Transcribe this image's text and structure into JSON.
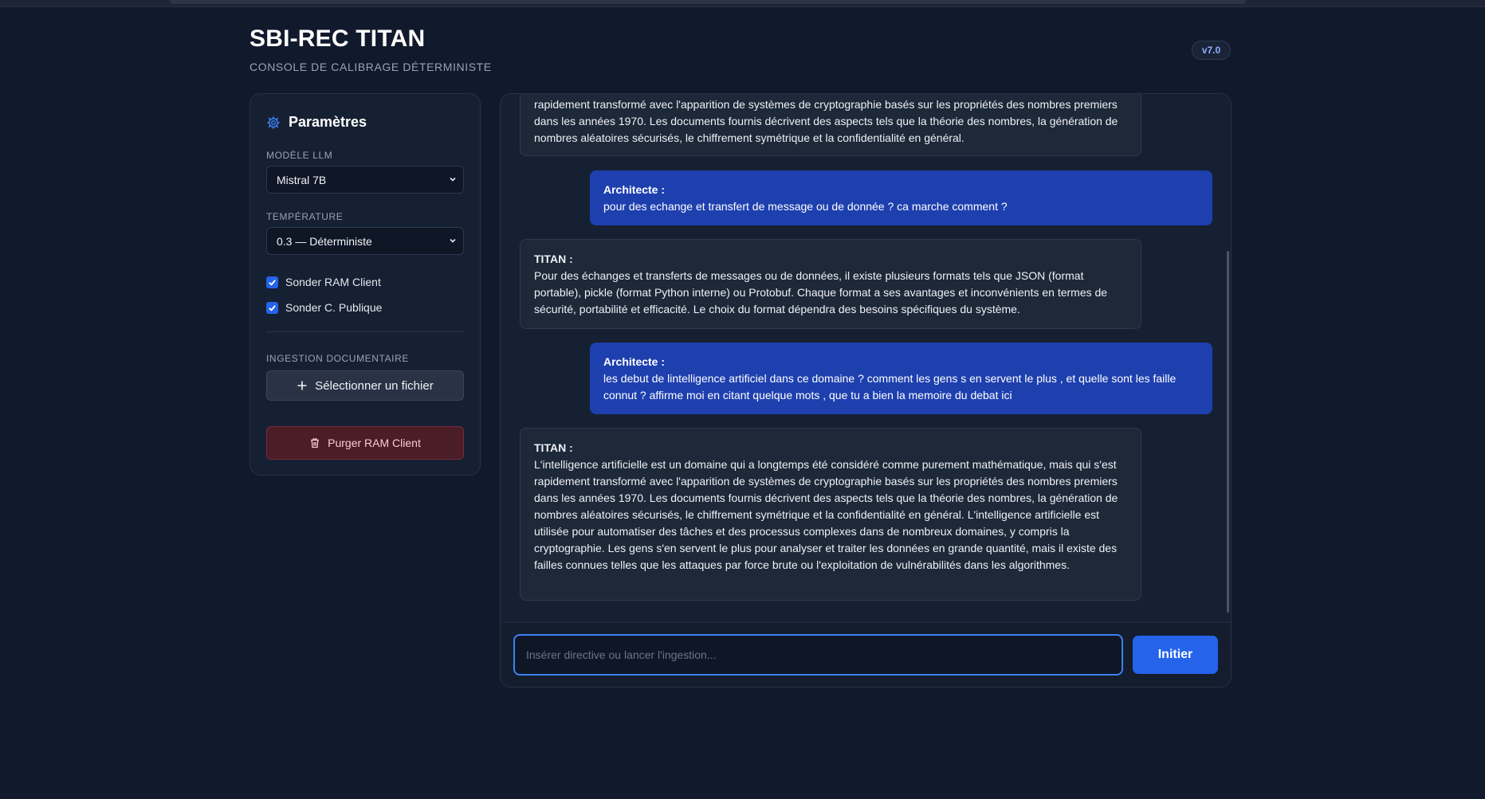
{
  "header": {
    "title": "SBI-REC TITAN",
    "subtitle": "CONSOLE DE CALIBRAGE DÉTERMINISTE",
    "version": "v7.0"
  },
  "sidebar": {
    "title": "Paramètres",
    "model_label": "MODÈLE LLM",
    "model_value": "Mistral 7B",
    "temperature_label": "TEMPÉRATURE",
    "temperature_value": "0.3 — Déterministe",
    "checkboxes": [
      {
        "label": "Sonder RAM Client",
        "checked": true
      },
      {
        "label": "Sonder C. Publique",
        "checked": true
      }
    ],
    "ingestion_label": "INGESTION DOCUMENTAIRE",
    "file_button": "Sélectionner un fichier",
    "purge_button": "Purger RAM Client"
  },
  "messages": [
    {
      "role": "titan",
      "text": "rapidement transformé avec l'apparition de systèmes de cryptographie basés sur les propriétés des nombres premiers dans les années 1970. Les documents fournis décrivent des aspects tels que la théorie des nombres, la génération de nombres aléatoires sécurisés, le chiffrement symétrique et la confidentialité en général."
    },
    {
      "role": "user",
      "speaker": "Architecte :",
      "text": "pour des echange et transfert de message ou de donnée ? ca marche comment ?"
    },
    {
      "role": "titan",
      "speaker": "TITAN :",
      "text": "Pour des échanges et transferts de messages ou de données, il existe plusieurs formats tels que JSON (format portable), pickle (format Python interne) ou Protobuf. Chaque format a ses avantages et inconvénients en termes de sécurité, portabilité et efficacité. Le choix du format dépendra des besoins spécifiques du système."
    },
    {
      "role": "user",
      "speaker": "Architecte :",
      "text": "les debut de lintelligence artificiel dans ce domaine ? comment les gens s en servent le plus , et quelle sont les faille connut ? affirme moi en citant quelque mots , que tu a bien la memoire du debat ici"
    },
    {
      "role": "titan",
      "speaker": "TITAN :",
      "text": "L'intelligence artificielle est un domaine qui a longtemps été considéré comme purement mathématique, mais qui s'est rapidement transformé avec l'apparition de systèmes de cryptographie basés sur les propriétés des nombres premiers dans les années 1970. Les documents fournis décrivent des aspects tels que la théorie des nombres, la génération de nombres aléatoires sécurisés, le chiffrement symétrique et la confidentialité en général. L'intelligence artificielle est utilisée pour automatiser des tâches et des processus complexes dans de nombreux domaines, y compris la cryptographie. Les gens s'en servent le plus pour analyser et traiter les données en grande quantité, mais il existe des failles connues telles que les attaques par force brute ou l'exploitation de vulnérabilités dans les algorithmes."
    }
  ],
  "composer": {
    "placeholder": "Insérer directive ou lancer l'ingestion...",
    "send_label": "Initier"
  },
  "colors": {
    "background": "#111a2c",
    "panel": "#162033",
    "accent": "#2563eb",
    "user_bubble": "#1e40af",
    "danger": "#4a1d27"
  }
}
